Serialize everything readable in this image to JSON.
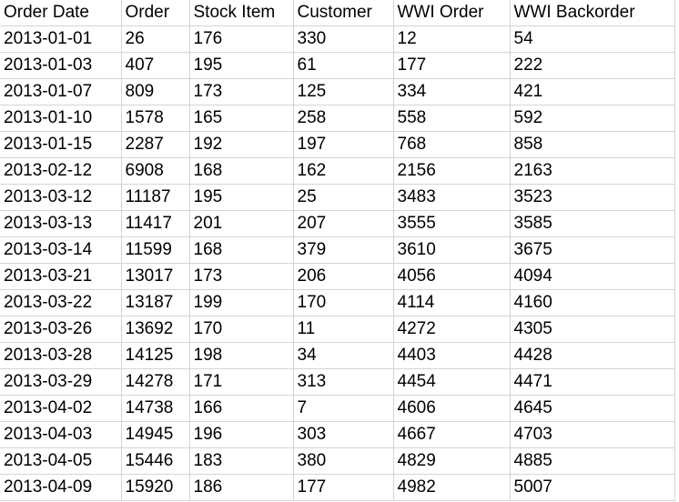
{
  "table": {
    "columns": [
      {
        "key": "order_date",
        "label": "Order Date"
      },
      {
        "key": "order",
        "label": "Order"
      },
      {
        "key": "stock_item",
        "label": "Stock Item"
      },
      {
        "key": "customer",
        "label": "Customer"
      },
      {
        "key": "wwi_order",
        "label": "WWI Order"
      },
      {
        "key": "wwi_backorder",
        "label": "WWI Backorder"
      }
    ],
    "rows": [
      [
        "2013-01-01",
        "26",
        "176",
        "330",
        "12",
        "54"
      ],
      [
        "2013-01-03",
        "407",
        "195",
        "61",
        "177",
        "222"
      ],
      [
        "2013-01-07",
        "809",
        "173",
        "125",
        "334",
        "421"
      ],
      [
        "2013-01-10",
        "1578",
        "165",
        "258",
        "558",
        "592"
      ],
      [
        "2013-01-15",
        "2287",
        "192",
        "197",
        "768",
        "858"
      ],
      [
        "2013-02-12",
        "6908",
        "168",
        "162",
        "2156",
        "2163"
      ],
      [
        "2013-03-12",
        "11187",
        "195",
        "25",
        "3483",
        "3523"
      ],
      [
        "2013-03-13",
        "11417",
        "201",
        "207",
        "3555",
        "3585"
      ],
      [
        "2013-03-14",
        "11599",
        "168",
        "379",
        "3610",
        "3675"
      ],
      [
        "2013-03-21",
        "13017",
        "173",
        "206",
        "4056",
        "4094"
      ],
      [
        "2013-03-22",
        "13187",
        "199",
        "170",
        "4114",
        "4160"
      ],
      [
        "2013-03-26",
        "13692",
        "170",
        "11",
        "4272",
        "4305"
      ],
      [
        "2013-03-28",
        "14125",
        "198",
        "34",
        "4403",
        "4428"
      ],
      [
        "2013-03-29",
        "14278",
        "171",
        "313",
        "4454",
        "4471"
      ],
      [
        "2013-04-02",
        "14738",
        "166",
        "7",
        "4606",
        "4645"
      ],
      [
        "2013-04-03",
        "14945",
        "196",
        "303",
        "4667",
        "4703"
      ],
      [
        "2013-04-05",
        "15446",
        "183",
        "380",
        "4829",
        "4885"
      ],
      [
        "2013-04-09",
        "15920",
        "186",
        "177",
        "4982",
        "5007"
      ]
    ],
    "grid_line_color": "#d4d4d4",
    "text_color": "#000000",
    "background_color": "#ffffff"
  }
}
